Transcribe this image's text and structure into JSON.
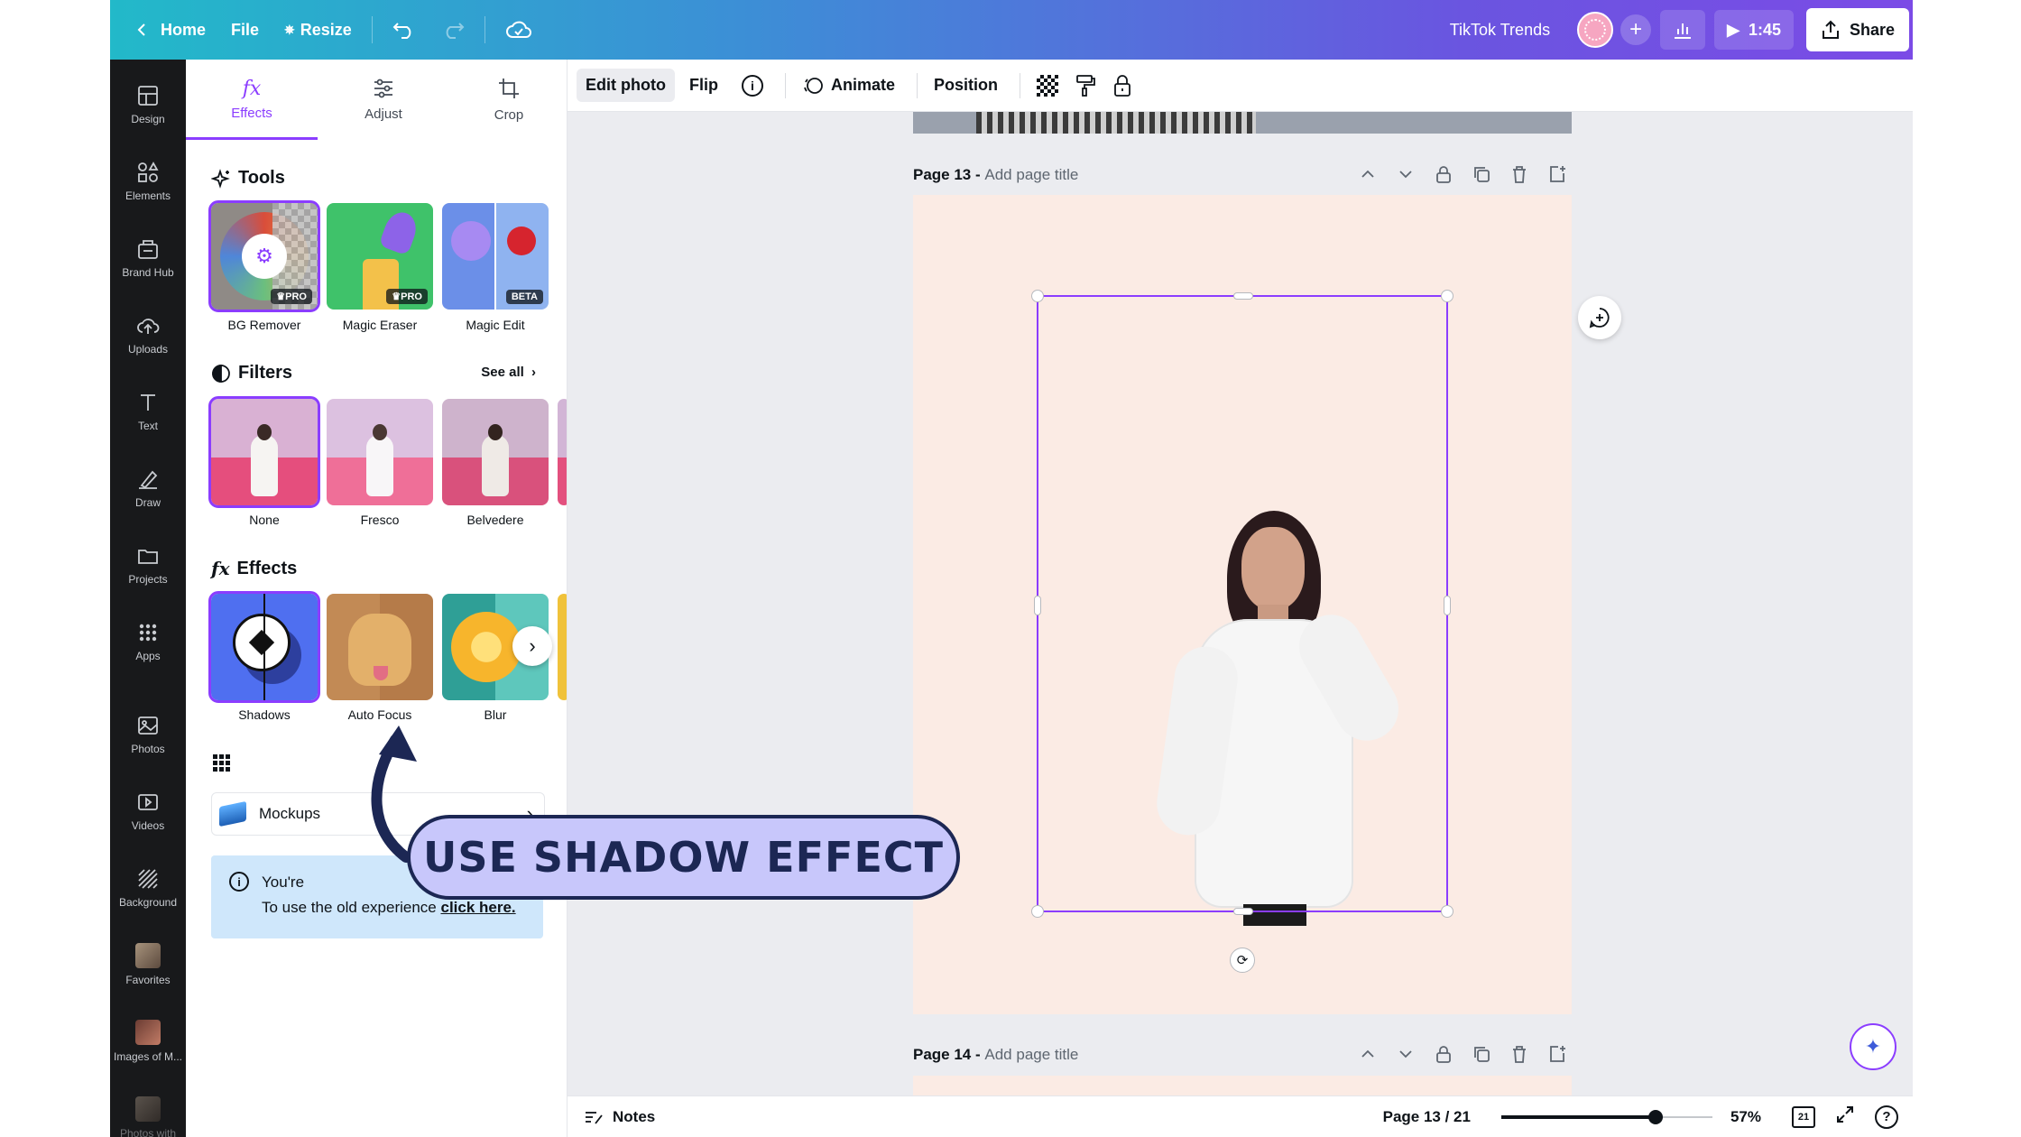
{
  "topbar": {
    "home_label": "Home",
    "file_label": "File",
    "resize_label": "Resize",
    "project_title": "TikTok Trends",
    "timer_label": "1:45",
    "share_label": "Share"
  },
  "rail": {
    "items": [
      {
        "label": "Design"
      },
      {
        "label": "Elements"
      },
      {
        "label": "Brand Hub"
      },
      {
        "label": "Uploads"
      },
      {
        "label": "Text"
      },
      {
        "label": "Draw"
      },
      {
        "label": "Projects"
      },
      {
        "label": "Apps"
      },
      {
        "label": "Photos"
      },
      {
        "label": "Videos"
      },
      {
        "label": "Background"
      },
      {
        "label": "Favorites"
      },
      {
        "label": "Images of M..."
      },
      {
        "label": "Photos with"
      }
    ]
  },
  "panel": {
    "tabs": [
      {
        "label": "Effects",
        "icon": "fx"
      },
      {
        "label": "Adjust"
      },
      {
        "label": "Crop"
      }
    ],
    "tools": {
      "title": "Tools",
      "items": [
        {
          "label": "BG Remover",
          "badge": "PRO"
        },
        {
          "label": "Magic Eraser",
          "badge": "PRO"
        },
        {
          "label": "Magic Edit",
          "badge": "BETA"
        }
      ]
    },
    "filters": {
      "title": "Filters",
      "see_all": "See all",
      "items": [
        {
          "label": "None"
        },
        {
          "label": "Fresco"
        },
        {
          "label": "Belvedere"
        }
      ]
    },
    "effects": {
      "title": "Effects",
      "items": [
        {
          "label": "Shadows"
        },
        {
          "label": "Auto Focus"
        },
        {
          "label": "Blur"
        }
      ]
    },
    "apps": {
      "mockups_label": "Mockups"
    },
    "notice": {
      "line1": "You're",
      "line2": "To use the old experience",
      "link": "click here."
    }
  },
  "ctx": {
    "edit_photo": "Edit photo",
    "flip": "Flip",
    "animate": "Animate",
    "position": "Position"
  },
  "canvas": {
    "page13_label": "Page 13 -",
    "page13_placeholder": "Add page title",
    "page14_label": "Page 14 -",
    "page14_placeholder": "Add page title"
  },
  "bottombar": {
    "notes_label": "Notes",
    "page_indicator": "Page 13 / 21",
    "zoom_label": "57%",
    "zoom_fraction": 0.57,
    "grid_count": "21"
  },
  "callout": {
    "text": "USE SHADOW EFFECT"
  },
  "colors": {
    "accent": "#8b3dff",
    "page_bg": "#fbebe4",
    "callout_fill": "#c8c7fb",
    "callout_border": "#1c2754"
  }
}
